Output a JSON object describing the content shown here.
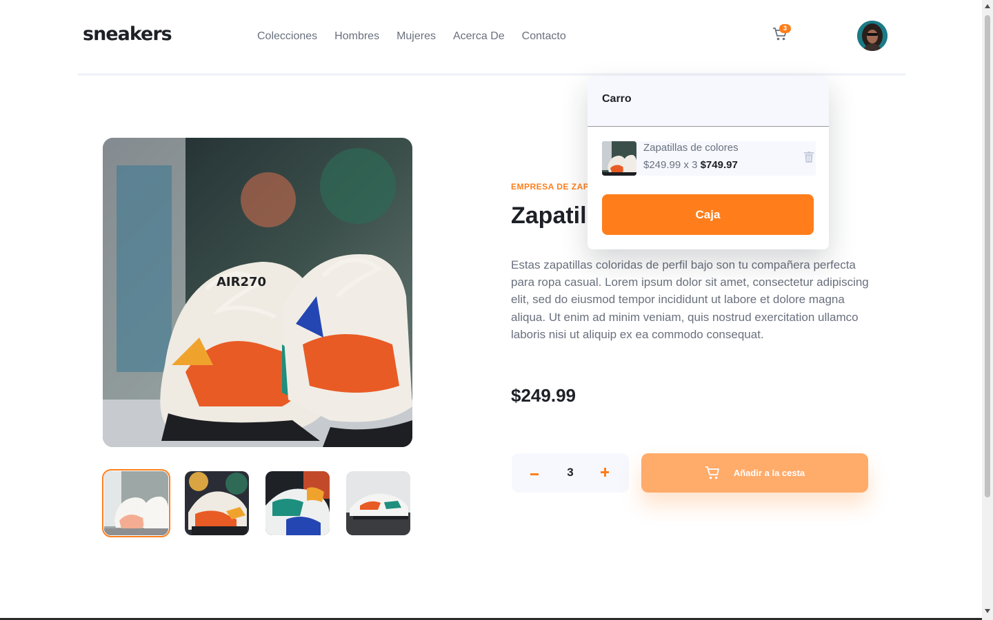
{
  "brand": {
    "logo": "sneakers"
  },
  "nav": {
    "items": [
      "Colecciones",
      "Hombres",
      "Mujeres",
      "Acerca De",
      "Contacto"
    ]
  },
  "header": {
    "cart_count": "3"
  },
  "product": {
    "company": "EMPRESA DE ZAPATILLAS",
    "title": "Zapatillas de colores",
    "description": "Estas zapatillas coloridas de perfil bajo son tu compañera perfecta para ropa casual. Lorem ipsum dolor sit amet, consectetur adipiscing elit, sed do eiusmod tempor incididunt ut labore et dolore magna aliqua. Ut enim ad minim veniam, quis nostrud exercitation ullamco laboris nisi ut aliquip ex ea commodo consequat.",
    "price": "$249.99",
    "quantity": "3",
    "add_to_cart_label": "Añadir a la cesta"
  },
  "cart": {
    "title": "Carro",
    "items": [
      {
        "name": "Zapatillas de colores",
        "unit_price": "$249.99",
        "qty_text": "x 3",
        "total": "$749.97"
      }
    ],
    "checkout_label": "Caja"
  },
  "colors": {
    "accent": "#ff7e1b",
    "accent_light": "#ffab6a",
    "text_dark": "#1d2026",
    "text_gray": "#69707d",
    "panel_bg": "#f6f8fd"
  },
  "icons": [
    "cart-icon",
    "avatar",
    "minus-icon",
    "plus-icon",
    "trash-icon"
  ]
}
